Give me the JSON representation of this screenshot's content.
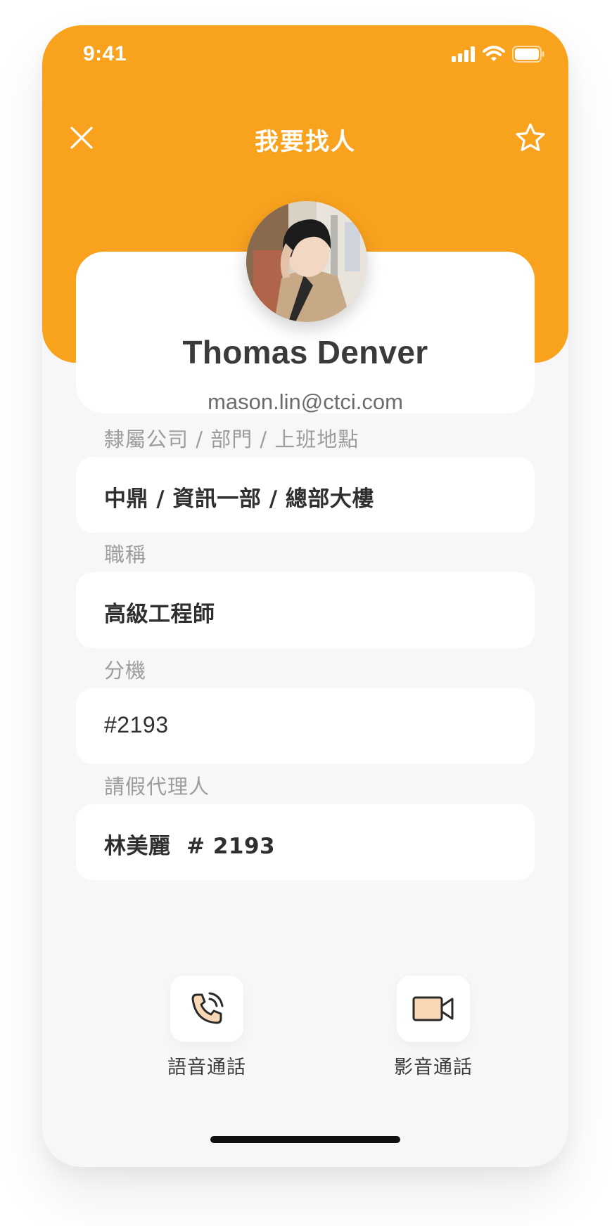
{
  "status_bar": {
    "time": "9:41"
  },
  "header": {
    "title": "我要找人",
    "accent_color": "#f9a21e",
    "close_icon": "close-icon",
    "favorite_icon": "star-outline-icon"
  },
  "profile": {
    "name": "Thomas Denver",
    "email": "mason.lin@ctci.com",
    "avatar": "profile-photo"
  },
  "fields": [
    {
      "label": "隸屬公司 / 部門 / 上班地點",
      "value": "中鼎 / 資訊一部 / 總部大樓"
    },
    {
      "label": "職稱",
      "value": "高級工程師"
    },
    {
      "label": "分機",
      "value": "#2193"
    },
    {
      "label": "請假代理人",
      "value": "林美麗  # 2193"
    }
  ],
  "actions": [
    {
      "label": "語音通話",
      "icon": "phone-call-icon"
    },
    {
      "label": "影音通話",
      "icon": "video-camera-icon"
    }
  ]
}
